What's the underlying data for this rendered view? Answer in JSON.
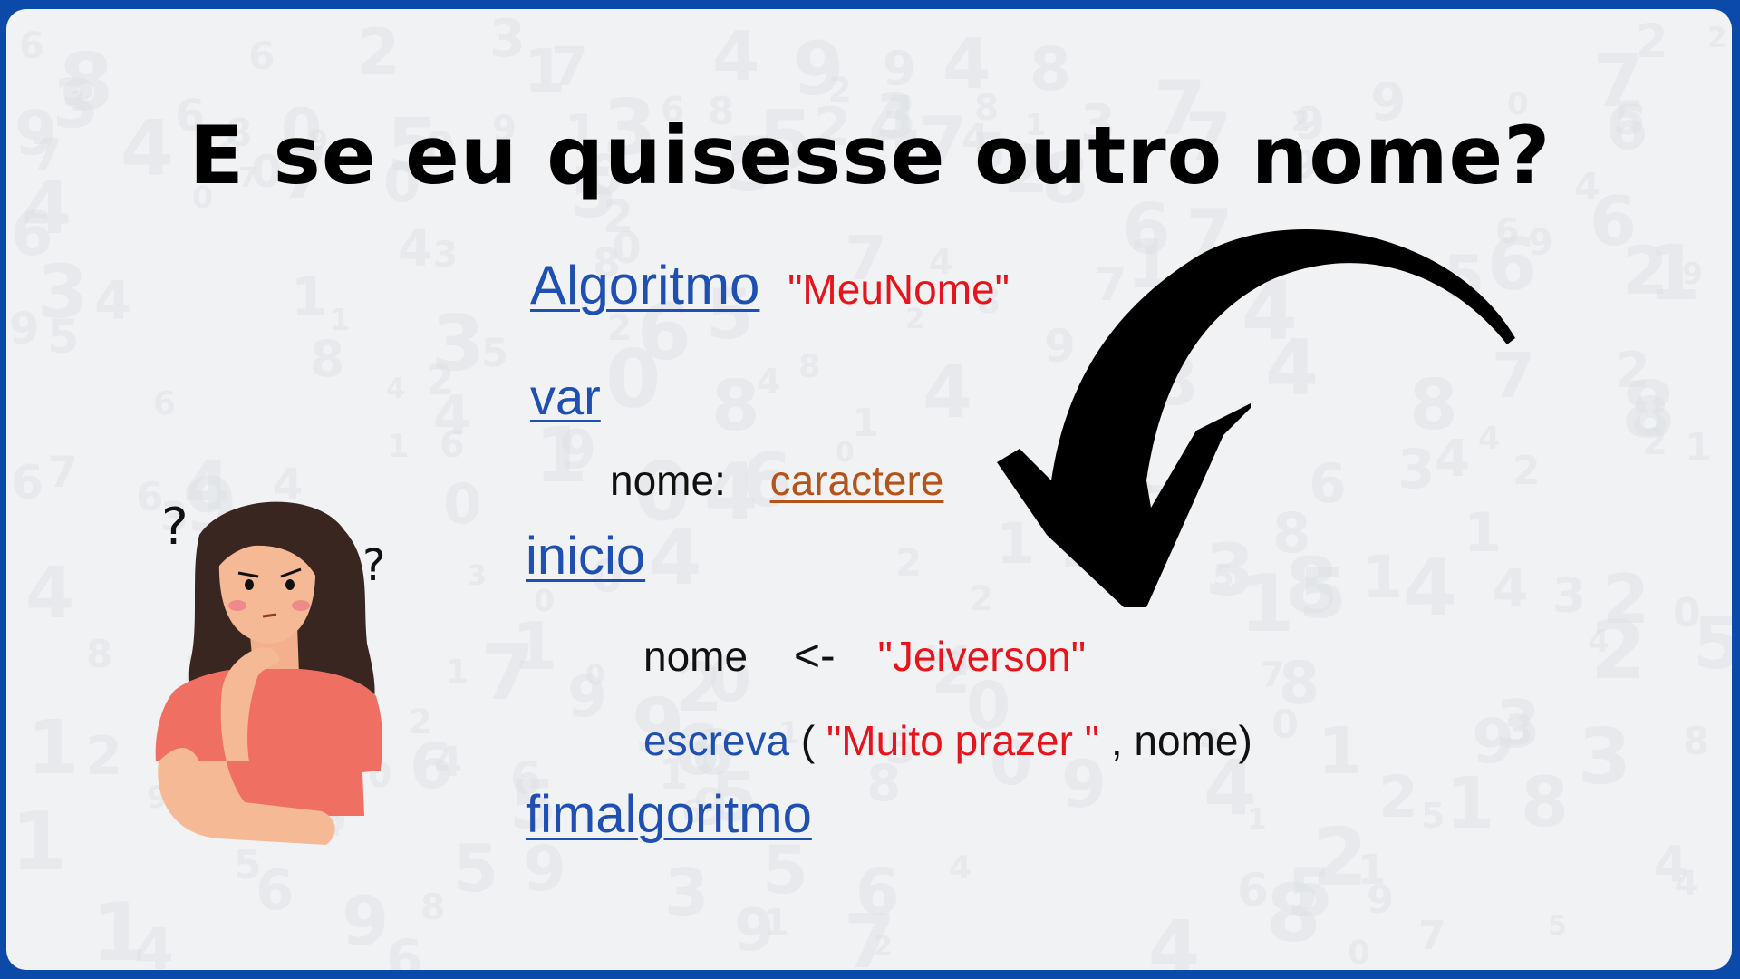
{
  "slide": {
    "title": "E se eu quisesse outro nome?",
    "colors": {
      "frame": "#0b4aa8",
      "keyword": "#1f4fb0",
      "string": "#e8141b",
      "type": "#b5541a"
    },
    "code": {
      "algoritmo_kw": "Algoritmo",
      "algoritmo_name": "\"MeuNome\"",
      "var_kw": "var",
      "decl_name": "nome:",
      "decl_type": "caractere",
      "inicio_kw": "inicio",
      "assign_var": "nome",
      "assign_op": "<-",
      "assign_value": "\"Jeiverson\"",
      "escreva_kw": "escreva",
      "escreva_open": "(",
      "escreva_string": "\"Muito prazer \"",
      "escreva_rest": ", nome)",
      "fim_kw": "fimalgoritmo"
    },
    "illustration": {
      "question_mark_left": "?",
      "question_mark_right": "?"
    },
    "icons": [
      "curved-arrow-icon",
      "thinking-woman-illustration"
    ]
  }
}
